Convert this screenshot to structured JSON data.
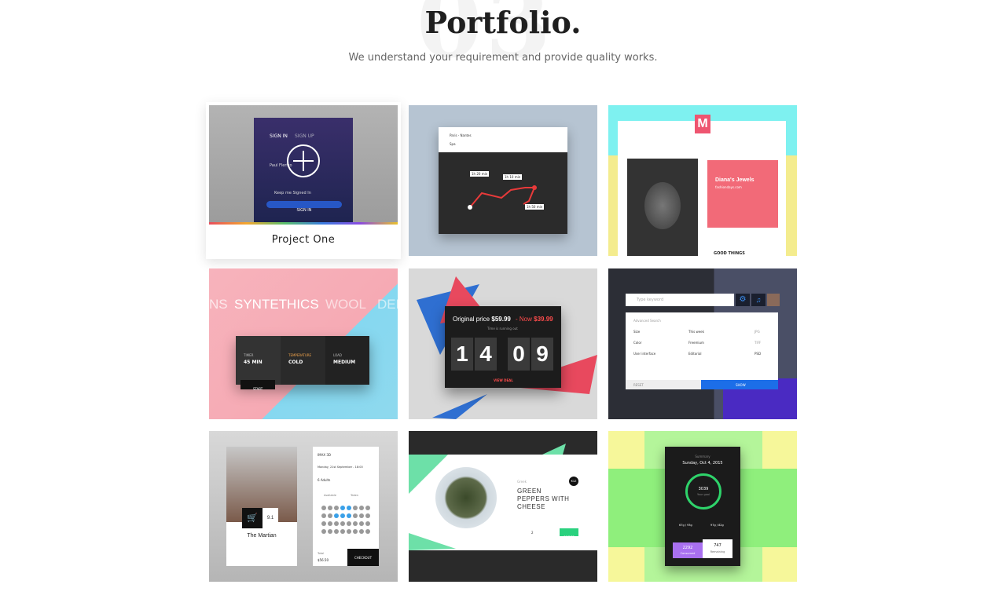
{
  "header": {
    "background_number": "03",
    "title": "Portfolio.",
    "subtitle": "We understand your requirement and provide quality works."
  },
  "project_one": {
    "label": "Project One",
    "tabs": [
      "SIGN IN",
      "SIGN UP"
    ],
    "fields": [
      "Paul Flerico",
      ""
    ],
    "remember": "Keep me Signed In",
    "button": "SIGN IN"
  },
  "tile_map": {
    "route_from": "Paris - Nantes",
    "route_to": "Spa",
    "times": [
      "1h 20 min",
      "1h 10 min",
      "1h 50 min"
    ]
  },
  "tile_jewels": {
    "logo": "M",
    "card_title": "Diana's Jewels",
    "card_subtitle": "fashiondays.com",
    "good_things": "GOOD THINGS"
  },
  "tile_synthetics": {
    "words": [
      "NS",
      "SYNTETHICS",
      "WOOL",
      "DEL"
    ],
    "options": [
      {
        "label": "TIMER",
        "value": "45 MIN"
      },
      {
        "label": "TEMPERATURE",
        "value": "COLD"
      },
      {
        "label": "LOAD",
        "value": "MEDIUM"
      }
    ],
    "start": "START"
  },
  "tile_price": {
    "original_label": "Original price",
    "original_price": "$59.99",
    "now_label": "- Now",
    "now_price": "$39.99",
    "running_out": "Time is running out",
    "digits": [
      "1",
      "4",
      "0",
      "9"
    ],
    "cta": "VIEW DEAL"
  },
  "tile_search": {
    "placeholder": "Type keyword",
    "section": "Advanced Search",
    "col1": [
      "Size",
      "Color",
      "User interface"
    ],
    "col2": [
      "This week",
      "Freemium",
      "Editorial"
    ],
    "col3": [
      "JPG",
      "TIFF",
      "PSD"
    ],
    "reset": "RESET",
    "search": "SHOW"
  },
  "tile_movie": {
    "movie_title": "The Martian",
    "rating": "9.1",
    "screen": "IMAX 3D",
    "date": "Monday, 21st September - 18:00",
    "adults": "6 Adults",
    "available": "Available",
    "taken": "Taken",
    "total_label": "Total",
    "total": "$56.50",
    "checkout": "CHECKOUT"
  },
  "tile_food": {
    "category": "Greek",
    "dish": "GREEN PEPPERS WITH CHEESE",
    "price": "€12",
    "order": "ORDER",
    "qty": "2"
  },
  "tile_fitness": {
    "label": "Summary",
    "date": "Sunday, Oct 4, 2015",
    "goal": "3039",
    "goal_label": "Your goal",
    "stat1": "67g / 93g",
    "stat2": "97g / 82g",
    "consumed": "2292",
    "consumed_label": "Consumed",
    "remaining": "747",
    "remaining_label": "Remaining"
  }
}
